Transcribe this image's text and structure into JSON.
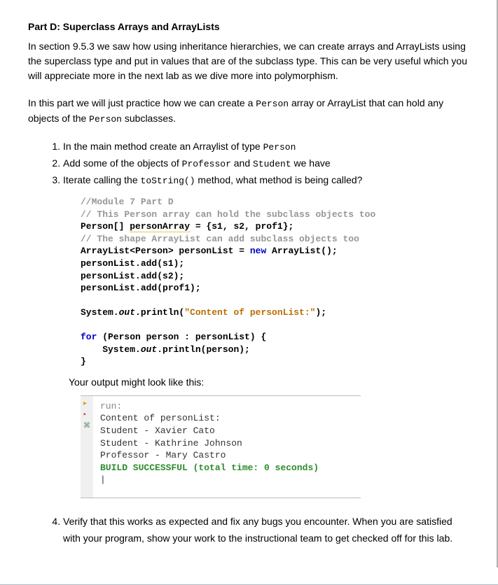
{
  "title": "Part D: Superclass Arrays and ArrayLists",
  "para1_parts": [
    "In section 9.5.3 we saw how using inheritance hierarchies, we can create arrays and ArrayLists using the superclass type and put in values that are of the subclass type. This can be very useful which you will appreciate more in the next lab as we dive more into polymorphism."
  ],
  "para2": {
    "pre": "In this part we will just practice how we can create a ",
    "code1": "Person",
    "mid": " array or ArrayList that can hold any objects of the ",
    "code2": "Person",
    "post": " subclasses."
  },
  "steps": {
    "s1": {
      "pre": "In the main method create an Arraylist of type ",
      "code": "Person"
    },
    "s2": {
      "pre": "Add some of the objects of ",
      "code1": "Professor",
      "mid": " and ",
      "code2": "Student",
      "post": " we have"
    },
    "s3": {
      "pre": "Iterate calling the ",
      "code": " toString()",
      "post": " method, what method is being called?"
    }
  },
  "code": {
    "l1": "//Module 7 Part D",
    "l2": "// This Person array can hold the subclass objects too",
    "l3a": "Person[] ",
    "l3b": "personArray",
    "l3c": " = {s1, s2, prof1};",
    "l4": "// The shape ArrayList can add subclass objects too",
    "l5a": "ArrayList<Person> personList = ",
    "l5b": "new",
    "l5c": " ArrayList();",
    "l6": "personList.add(s1);",
    "l7": "personList.add(s2);",
    "l8": "personList.add(prof1);",
    "l9a": "System.",
    "l9b": "out",
    "l9c": ".println(",
    "l9d": "\"Content of personList:\"",
    "l9e": ");",
    "l10a": "for",
    "l10b": " (Person person : personList) {",
    "l11a": "    System.",
    "l11b": "out",
    "l11c": ".println(person);",
    "l12": "}"
  },
  "output_intro": "Your output might look like this:",
  "output": {
    "run": "run:",
    "l1": "Content of personList:",
    "l2": "Student - Xavier Cato",
    "l3": "Student - Kathrine Johnson",
    "l4": "Professor - Mary Castro",
    "build": "BUILD SUCCESSFUL (total time: 0 seconds)",
    "cursor": "|"
  },
  "step4": "Verify that this works as expected and fix any bugs you encounter. When you are satisfied with your program, show your work to the instructional team to get checked off for this lab."
}
